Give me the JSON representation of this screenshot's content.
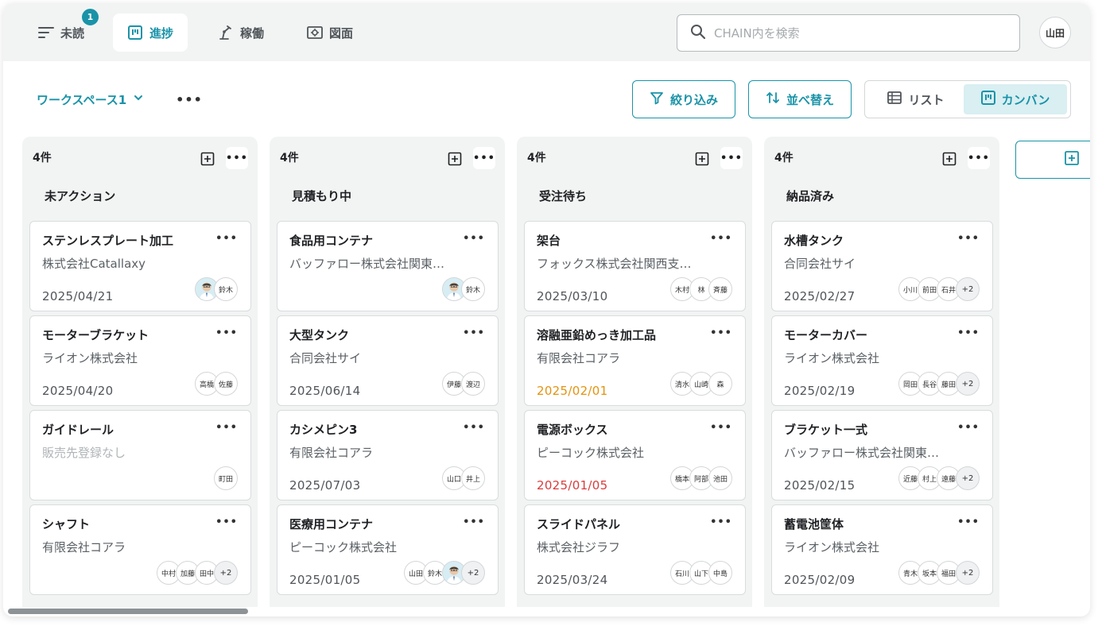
{
  "topbar": {
    "tabs": [
      {
        "label": "未読",
        "icon": "filter-lines-icon",
        "badge": "1"
      },
      {
        "label": "進捗",
        "icon": "kanban-icon"
      },
      {
        "label": "稼働",
        "icon": "machine-arm-icon"
      },
      {
        "label": "図面",
        "icon": "drawing-icon"
      }
    ],
    "search_placeholder": "CHAIN内を検索",
    "user_initials": "山田"
  },
  "toolbar": {
    "workspace": "ワークスペース1",
    "filter_label": "絞り込み",
    "sort_label": "並べ替え",
    "view_list_label": "リスト",
    "view_kanban_label": "カンバン",
    "active_view": "カンバン"
  },
  "colors": {
    "accent": "#1a93a8",
    "warn_date": "#e2930f",
    "danger_date": "#d93c3c"
  },
  "columns": [
    {
      "count": "4件",
      "title": "未アクション",
      "cards": [
        {
          "title": "ステンレスプレート加工",
          "client": "株式会社Catallaxy",
          "date": "2025/04/21",
          "assignees": [
            "photo",
            "鈴木"
          ]
        },
        {
          "title": "モーターブラケット",
          "client": "ライオン株式会社",
          "date": "2025/04/20",
          "assignees": [
            "高橋",
            "佐藤"
          ]
        },
        {
          "title": "ガイドレール",
          "client": "販売先登録なし",
          "date": "",
          "assignees": [
            "町田"
          ]
        },
        {
          "title": "シャフト",
          "client": "有限会社コアラ",
          "date": "",
          "assignees": [
            "中村",
            "加藤",
            "田中",
            "+2"
          ]
        }
      ]
    },
    {
      "count": "4件",
      "title": "見積もり中",
      "cards": [
        {
          "title": "食品用コンテナ",
          "client": "バッファロー株式会社関東…",
          "date": "",
          "assignees": [
            "photo",
            "鈴木"
          ]
        },
        {
          "title": "大型タンク",
          "client": "合同会社サイ",
          "date": "2025/06/14",
          "assignees": [
            "伊藤",
            "渡辺"
          ]
        },
        {
          "title": "カシメピン3",
          "client": "有限会社コアラ",
          "date": "2025/07/03",
          "assignees": [
            "山口",
            "井上"
          ]
        },
        {
          "title": "医療用コンテナ",
          "client": "ピーコック株式会社",
          "date": "2025/01/05",
          "assignees": [
            "山田",
            "鈴木",
            "photo",
            "+2"
          ]
        }
      ]
    },
    {
      "count": "4件",
      "title": "受注待ち",
      "cards": [
        {
          "title": "架台",
          "client": "フォックス株式会社関西支…",
          "date": "2025/03/10",
          "assignees": [
            "木村",
            "林",
            "斉藤"
          ]
        },
        {
          "title": "溶融亜鉛めっき加工品",
          "client": "有限会社コアラ",
          "date": "2025/02/01",
          "date_status": "warn",
          "assignees": [
            "清水",
            "山崎",
            "森"
          ]
        },
        {
          "title": "電源ボックス",
          "client": "ピーコック株式会社",
          "date": "2025/01/05",
          "date_status": "danger",
          "assignees": [
            "橋本",
            "阿部",
            "池田"
          ]
        },
        {
          "title": "スライドパネル",
          "client": "株式会社ジラフ",
          "date": "2025/03/24",
          "assignees": [
            "石川",
            "山下",
            "中島"
          ]
        }
      ]
    },
    {
      "count": "4件",
      "title": "納品済み",
      "cards": [
        {
          "title": "水槽タンク",
          "client": "合同会社サイ",
          "date": "2025/02/27",
          "assignees": [
            "小川",
            "前田",
            "石井",
            "+2"
          ]
        },
        {
          "title": "モーターカバー",
          "client": "ライオン株式会社",
          "date": "2025/02/19",
          "assignees": [
            "岡田",
            "長谷",
            "藤田",
            "+2"
          ]
        },
        {
          "title": "ブラケット一式",
          "client": "バッファロー株式会社関東…",
          "date": "2025/02/15",
          "assignees": [
            "近藤",
            "村上",
            "遠藤",
            "+2"
          ]
        },
        {
          "title": "蓄電池筐体",
          "client": "ライオン株式会社",
          "date": "2025/02/09",
          "assignees": [
            "青木",
            "坂本",
            "福田",
            "+2"
          ]
        }
      ]
    }
  ]
}
